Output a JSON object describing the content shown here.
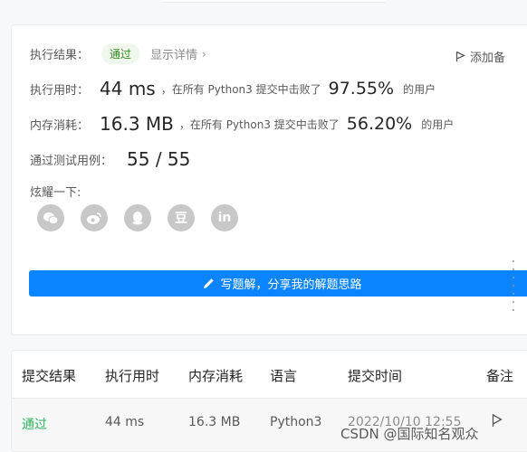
{
  "result": {
    "label": "执行结果：",
    "status": "通过",
    "detail_link": "显示详情",
    "detail_chevron": "›",
    "add_note": "添加备"
  },
  "runtime": {
    "label": "执行用时：",
    "value": "44 ms",
    "mid_text": "，在所有 Python3 提交中击败了",
    "percent": "97.55%",
    "suffix": "的用户"
  },
  "memory": {
    "label": "内存消耗：",
    "value": "16.3 MB",
    "mid_text": "，在所有 Python3 提交中击败了",
    "percent": "56.20%",
    "suffix": "的用户"
  },
  "testcases": {
    "label": "通过测试用例：",
    "value": "55 / 55"
  },
  "share": {
    "label": "炫耀一下:",
    "icons": [
      "wechat-icon",
      "weibo-icon",
      "qq-icon",
      "douban-icon",
      "linkedin-icon"
    ],
    "douban_glyph": "豆",
    "linkedin_glyph": "in"
  },
  "write_solution": {
    "label": "写题解，分享我的解题思路"
  },
  "submissions": {
    "headers": [
      "提交结果",
      "执行用时",
      "内存消耗",
      "语言",
      "提交时间",
      "备注"
    ],
    "rows": [
      {
        "result": "通过",
        "runtime": "44 ms",
        "memory": "16.3 MB",
        "language": "Python3",
        "time": "2022/10/10 12:55"
      }
    ]
  },
  "watermark": "CSDN @国际知名观众",
  "colors": {
    "accent": "#0a84ff",
    "pass": "#2db55d",
    "pill_bg": "#f0f7ec",
    "share_icon_bg": "#c8c8c8"
  }
}
